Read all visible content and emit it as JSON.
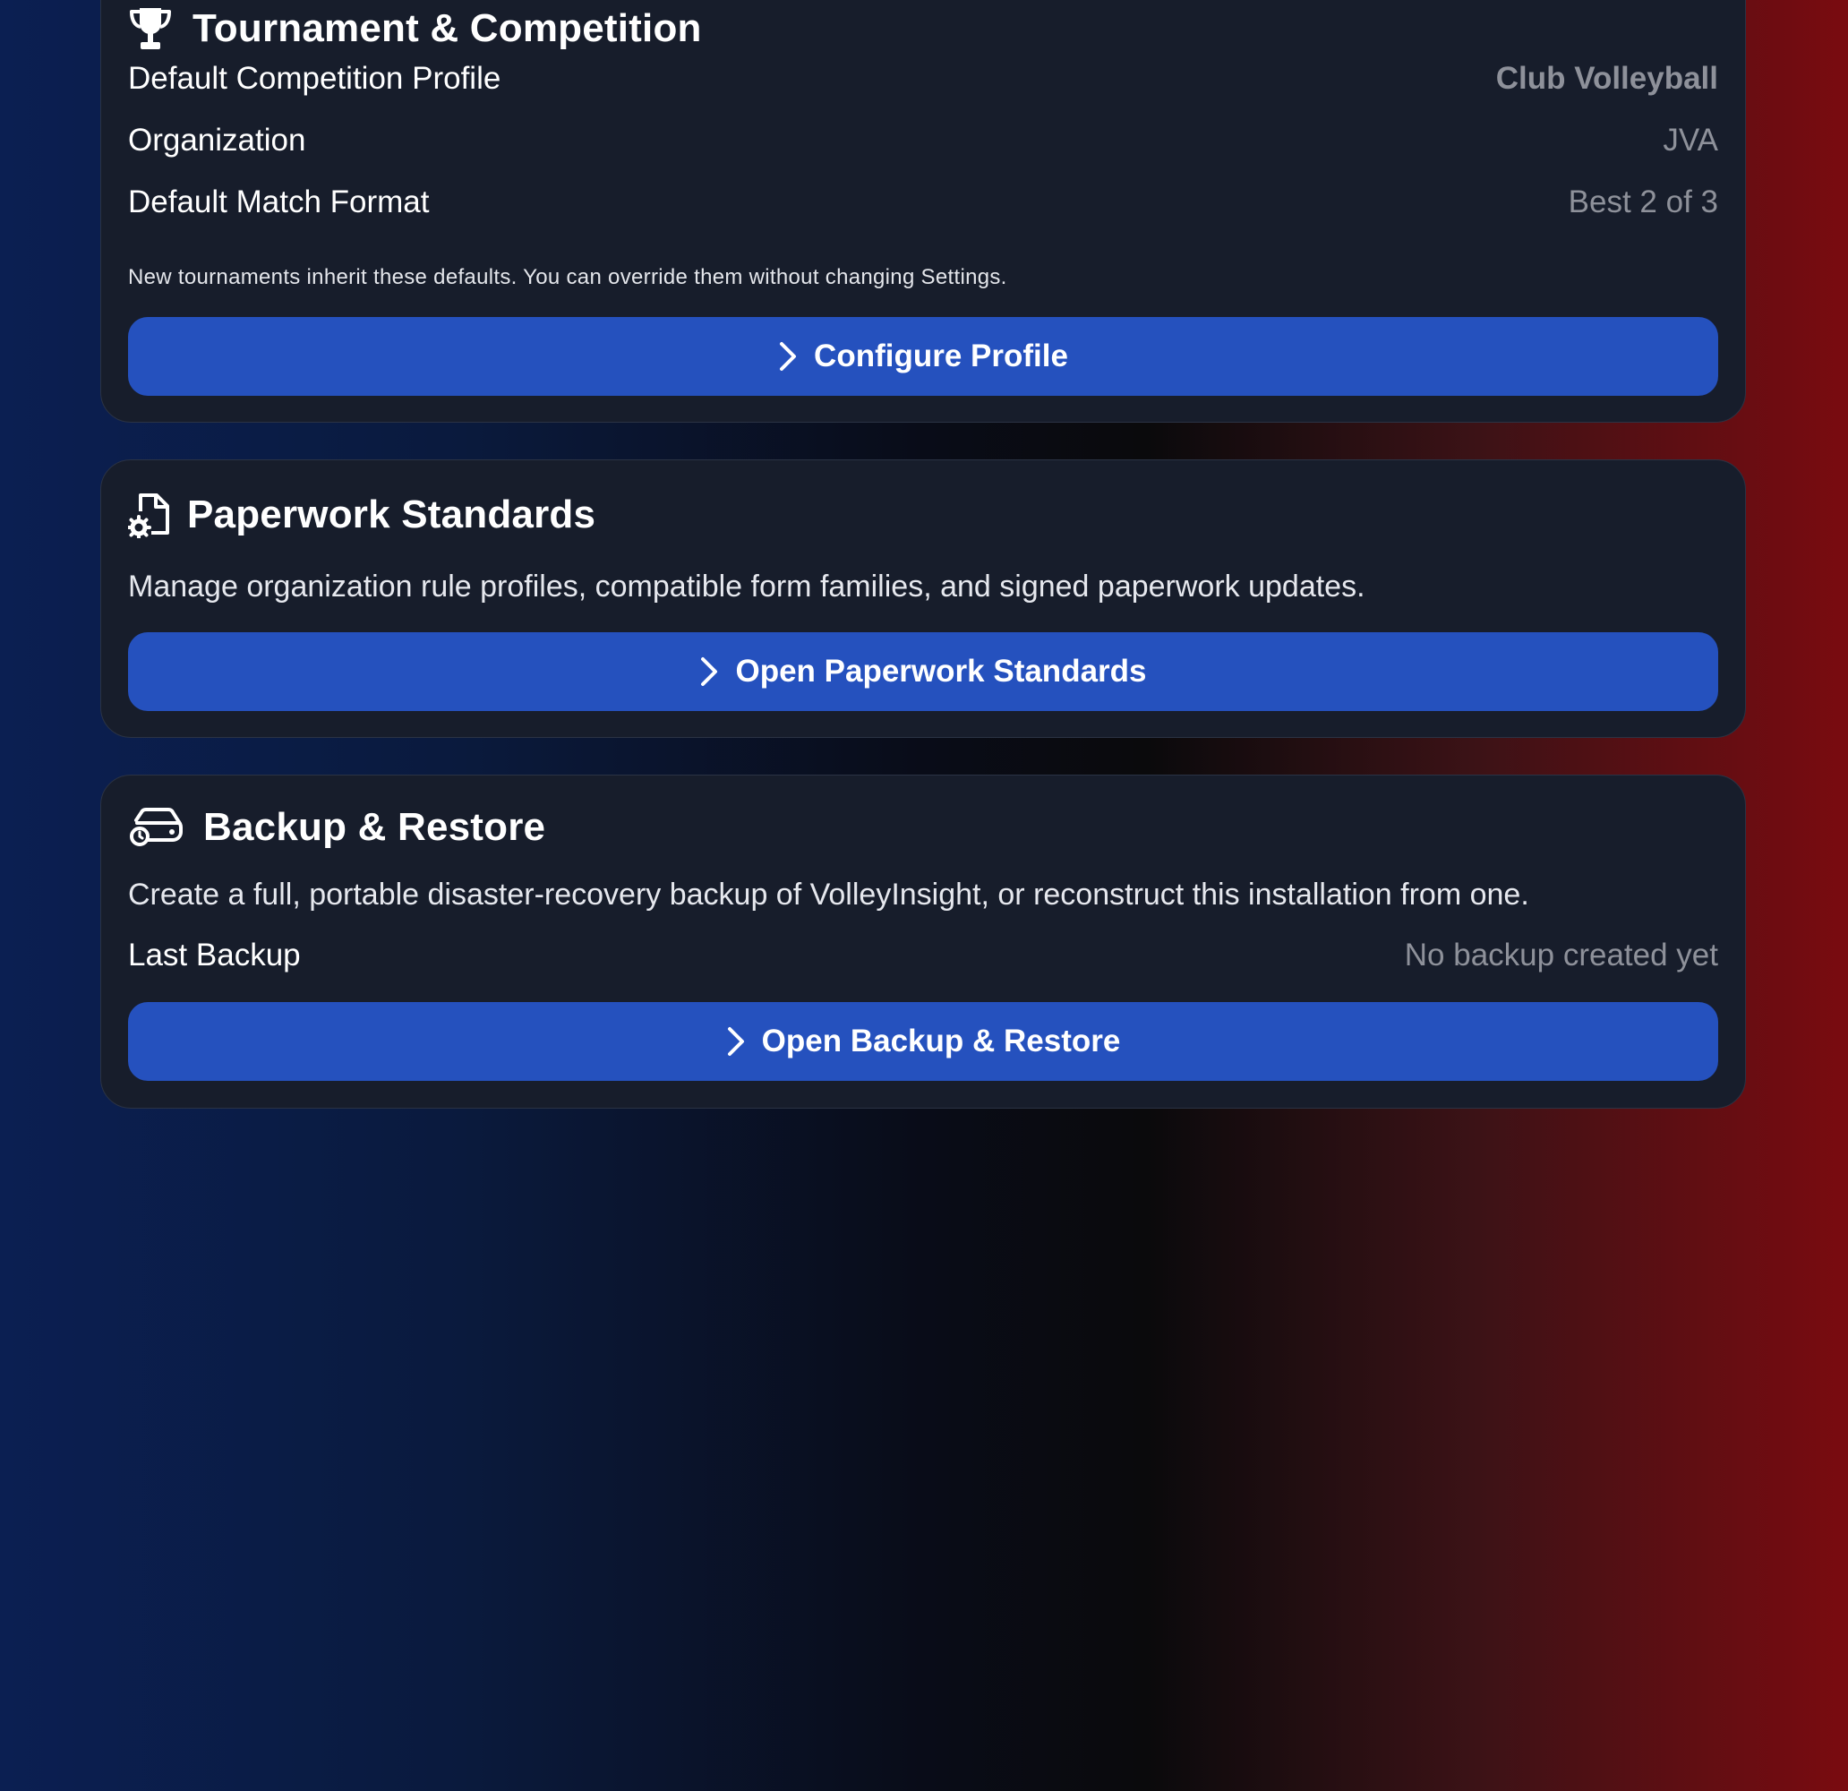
{
  "tournament": {
    "title": "Tournament & Competition",
    "icon": "trophy-icon",
    "rows": [
      {
        "label": "Default Competition Profile",
        "value": "Club Volleyball"
      },
      {
        "label": "Organization",
        "value": "JVA"
      },
      {
        "label": "Default Match Format",
        "value": "Best 2 of 3"
      }
    ],
    "note": "New tournaments inherit these defaults. You can override them without changing Settings.",
    "button_label": "Configure Profile"
  },
  "paperwork": {
    "title": "Paperwork Standards",
    "icon": "document-gear-icon",
    "description": "Manage organization rule profiles, compatible form families, and signed paperwork updates.",
    "button_label": "Open Paperwork Standards"
  },
  "backup": {
    "title": "Backup & Restore",
    "icon": "drive-restore-icon",
    "description": "Create a full, portable disaster-recovery backup of VolleyInsight, or reconstruct this installation from one.",
    "last_backup_label": "Last Backup",
    "last_backup_value": "No backup created yet",
    "button_label": "Open Backup & Restore"
  },
  "colors": {
    "button": "#2551be",
    "card": "#171d2b",
    "muted_text": "#8e919a",
    "gradient_left": "#0b1f52",
    "gradient_right": "#7a0b10"
  }
}
